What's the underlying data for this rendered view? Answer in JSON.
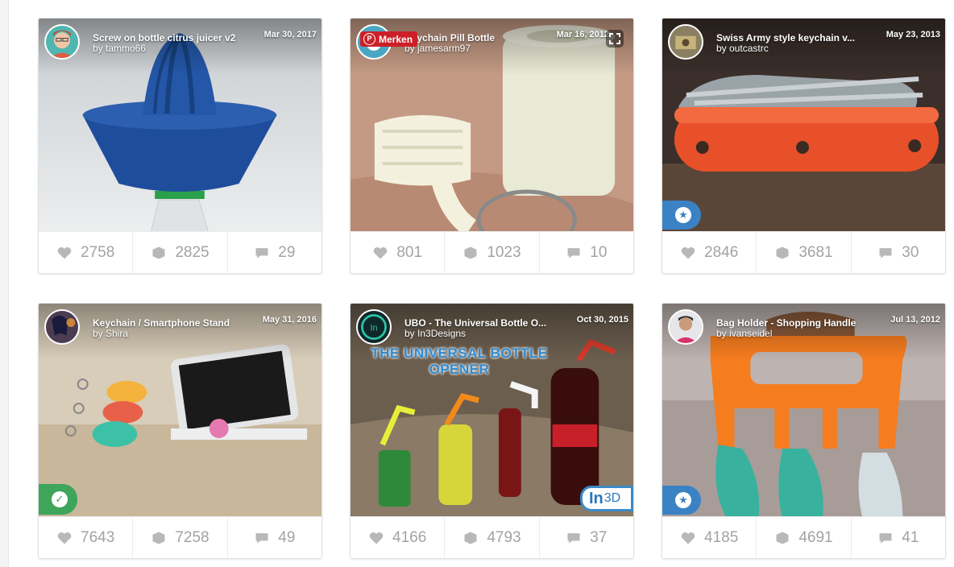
{
  "stat_icons": [
    "heart-icon",
    "cube-icon",
    "comment-icon"
  ],
  "pin_button": {
    "label": "Merken",
    "icon": "pinterest-icon"
  },
  "watermark": {
    "brand": "In",
    "suffix": "3D"
  },
  "cards": [
    {
      "title": "Screw on bottle citrus juicer v2",
      "author": "by tammo66",
      "date": "Mar 30, 2017",
      "likes": "2758",
      "makes": "2825",
      "comments": "29",
      "badge": null
    },
    {
      "title": "Keychain Pill Bottle",
      "author": "by jamesarm97",
      "date": "Mar 16, 2012",
      "likes": "801",
      "makes": "1023",
      "comments": "10",
      "badge": null
    },
    {
      "title": "Swiss Army style keychain v...",
      "author": "by outcastrc",
      "date": "May 23, 2013",
      "likes": "2846",
      "makes": "3681",
      "comments": "30",
      "badge": "featured"
    },
    {
      "title": "Keychain / Smartphone Stand",
      "author": "by Shira",
      "date": "May 31, 2016",
      "likes": "7643",
      "makes": "7258",
      "comments": "49",
      "badge": "made"
    },
    {
      "title": "UBO - The Universal Bottle O...",
      "author": "by In3Designs",
      "date": "Oct 30, 2015",
      "likes": "4166",
      "makes": "4793",
      "comments": "37",
      "badge": null,
      "image_text": [
        "THE UNIVERSAL BOTTLE",
        "OPENER"
      ]
    },
    {
      "title": "Bag Holder - Shopping Handle",
      "author": "by ivanseidel",
      "date": "Jul 13, 2012",
      "likes": "4185",
      "makes": "4691",
      "comments": "41",
      "badge": "featured"
    }
  ]
}
